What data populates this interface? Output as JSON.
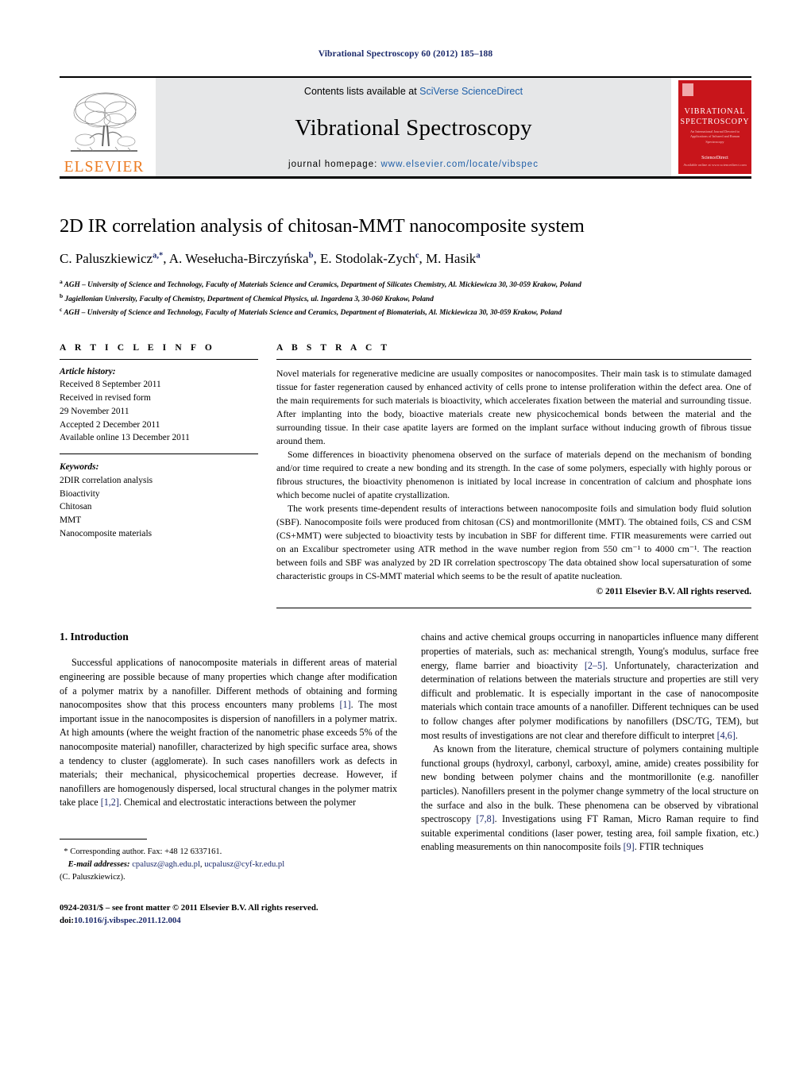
{
  "running_head": "Vibrational Spectroscopy 60 (2012) 185–188",
  "header": {
    "publisher": "ELSEVIER",
    "contents_prefix": "Contents lists available at ",
    "contents_link": "SciVerse ScienceDirect",
    "journal_title": "Vibrational Spectroscopy",
    "homepage_prefix": "journal homepage: ",
    "homepage_url": "www.elsevier.com/locate/vibspec",
    "cover": {
      "line1": "VIBRATIONAL",
      "line2": "SPECTROSCOPY",
      "subtitle": "An International Journal Devoted to Applications of Infrared and Raman Spectroscopy",
      "bottom": "Available online at www.sciencedirect.com",
      "logo": "ScienceDirect"
    },
    "accent_color": "#c8151b",
    "link_color": "#2060a8",
    "band_color": "#e6e7e8",
    "elsevier_orange": "#ec7c23"
  },
  "title": "2D IR correlation analysis of chitosan-MMT nanocomposite system",
  "authors_html": "C. Paluszkiewicz<sup>a,*</sup>, A. Wesełucha-Birczyńska<sup>b</sup>, E. Stodolak-Zych<sup>c</sup>, M. Hasik<sup>a</sup>",
  "affiliations": [
    "AGH – University of Science and Technology, Faculty of Materials Science and Ceramics, Department of Silicates Chemistry, Al. Mickiewicza 30, 30-059 Krakow, Poland",
    "Jagiellonian University, Faculty of Chemistry, Department of Chemical Physics, ul. Ingardena 3, 30-060 Krakow, Poland",
    "AGH – University of Science and Technology, Faculty of Materials Science and Ceramics, Department of Biomaterials, Al. Mickiewicza 30, 30-059 Krakow, Poland"
  ],
  "affiliation_marks": [
    "a",
    "b",
    "c"
  ],
  "article_info": {
    "heading": "A R T I C L E    I N F O",
    "history_label": "Article history:",
    "history": [
      "Received 8 September 2011",
      "Received in revised form",
      "29 November 2011",
      "Accepted 2 December 2011",
      "Available online 13 December 2011"
    ],
    "keywords_label": "Keywords:",
    "keywords": [
      "2DIR correlation analysis",
      "Bioactivity",
      "Chitosan",
      "MMT",
      "Nanocomposite materials"
    ]
  },
  "abstract": {
    "heading": "A B S T R A C T",
    "paragraphs": [
      "Novel materials for regenerative medicine are usually composites or nanocomposites. Their main task is to stimulate damaged tissue for faster regeneration caused by enhanced activity of cells prone to intense proliferation within the defect area. One of the main requirements for such materials is bioactivity, which accelerates fixation between the material and surrounding tissue. After implanting into the body, bioactive materials create new physicochemical bonds between the material and the surrounding tissue. In their case apatite layers are formed on the implant surface without inducing growth of fibrous tissue around them.",
      "Some differences in bioactivity phenomena observed on the surface of materials depend on the mechanism of bonding and/or time required to create a new bonding and its strength. In the case of some polymers, especially with highly porous or fibrous structures, the bioactivity phenomenon is initiated by local increase in concentration of calcium and phosphate ions which become nuclei of apatite crystallization.",
      "The work presents time-dependent results of interactions between nanocomposite foils and simulation body fluid solution (SBF). Nanocomposite foils were produced from chitosan (CS) and montmorillonite (MMT). The obtained foils, CS and CSM (CS+MMT) were subjected to bioactivity tests by incubation in SBF for different time. FTIR measurements were carried out on an Excalibur spectrometer using ATR method in the wave number region from 550 cm⁻¹ to 4000 cm⁻¹. The reaction between foils and SBF was analyzed by 2D IR correlation spectroscopy The data obtained show local supersaturation of some characteristic groups in CS-MMT material which seems to be the result of apatite nucleation."
    ],
    "copyright": "© 2011 Elsevier B.V. All rights reserved."
  },
  "introduction": {
    "number_title": "1.  Introduction",
    "left_paragraph_1": "Successful applications of nanocomposite materials in different areas of material engineering are possible because of many properties which change after modification of a polymer matrix by a nanofiller. Different methods of obtaining and forming nanocomposites show that this process encounters many problems ",
    "left_ref_1": "[1]",
    "left_paragraph_1b": ". The most important issue in the nanocomposites is dispersion of nanofillers in a polymer matrix. At high amounts (where the weight fraction of the nanometric phase exceeds 5% of the nanocomposite material) nanofiller, characterized by high specific surface area, shows a tendency to cluster (agglomerate). In such cases nanofillers work as defects in materials; their mechanical, physicochemical properties decrease. However, if nanofillers are homogenously dispersed, local structural changes in the polymer matrix take place ",
    "left_ref_2": "[1,2]",
    "left_paragraph_1c": ". Chemical and electrostatic interactions between the polymer",
    "right_paragraph_1": "chains and active chemical groups occurring in nanoparticles influence many different properties of materials, such as: mechanical strength, Young's modulus, surface free energy, flame barrier and bioactivity ",
    "right_ref_1": "[2–5]",
    "right_paragraph_1b": ". Unfortunately, characterization and determination of relations between the materials structure and properties are still very difficult and problematic. It is especially important in the case of nanocomposite materials which contain trace amounts of a nanofiller. Different techniques can be used to follow changes after polymer modifications by nanofillers (DSC/TG, TEM), but most results of investigations are not clear and therefore difficult to interpret ",
    "right_ref_2": "[4,6]",
    "right_paragraph_1c": ".",
    "right_paragraph_2": "As known from the literature, chemical structure of polymers containing multiple functional groups (hydroxyl, carbonyl, carboxyl, amine, amide) creates possibility for new bonding between polymer chains and the montmorillonite (e.g. nanofiller particles). Nanofillers present in the polymer change symmetry of the local structure on the surface and also in the bulk. These phenomena can be observed by vibrational spectroscopy ",
    "right_ref_3": "[7,8]",
    "right_paragraph_2b": ". Investigations using FT Raman, Micro Raman require to find suitable experimental conditions (laser power, testing area, foil sample fixation, etc.) enabling measurements on thin nanocomposite foils ",
    "right_ref_4": "[9]",
    "right_paragraph_2c": ". FTIR techniques"
  },
  "footnote": {
    "star": "*",
    "corresponding": "Corresponding author. Fax: +48 12 6337161.",
    "email_label": "E-mail addresses:",
    "email1": "cpalusz@agh.edu.pl",
    "email2": "ucpalusz@cyf-kr.edu.pl",
    "email_owner": "(C. Paluszkiewicz)."
  },
  "imprint": {
    "line1": "0924-2031/$ – see front matter © 2011 Elsevier B.V. All rights reserved.",
    "doi_label": "doi:",
    "doi": "10.1016/j.vibspec.2011.12.004"
  }
}
